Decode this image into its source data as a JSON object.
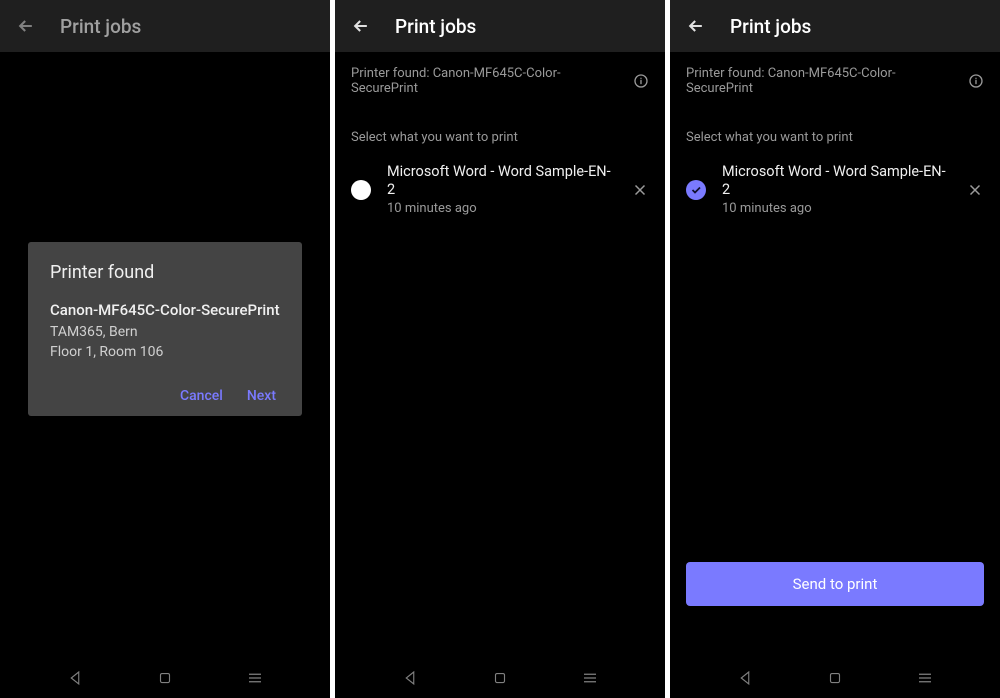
{
  "header": {
    "title": "Print jobs"
  },
  "modal": {
    "title": "Printer found",
    "printerName": "Canon-MF645C-Color-SecurePrint",
    "line1": "TAM365, Bern",
    "line2": "Floor 1, Room 106",
    "cancel": "Cancel",
    "next": "Next"
  },
  "printerBar": {
    "label": "Printer found: Canon-MF645C-Color-SecurePrint"
  },
  "selectPrompt": "Select what you want to print",
  "job": {
    "title": "Microsoft Word - Word Sample-EN-2",
    "time": "10 minutes ago"
  },
  "sendButton": "Send to print"
}
